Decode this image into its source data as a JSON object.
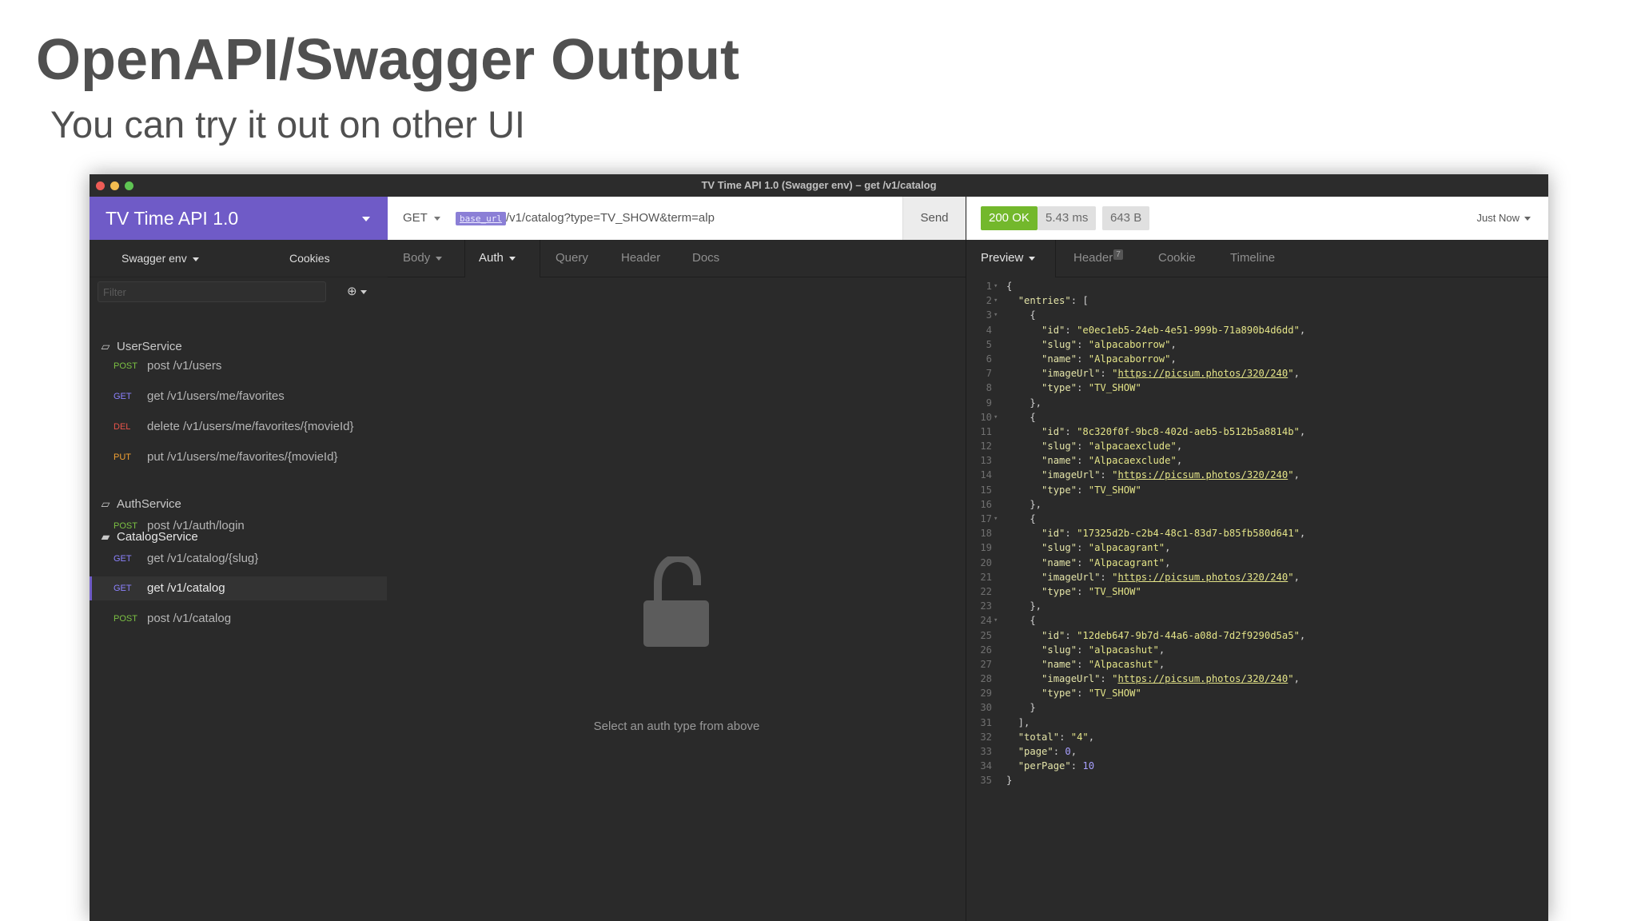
{
  "slide": {
    "title": "OpenAPI/Swagger Output",
    "subtitle": "You can try it out on other UI"
  },
  "window": {
    "title": "TV Time API 1.0 (Swagger env) – get /v1/catalog"
  },
  "sidebar": {
    "workspace": "TV Time API 1.0",
    "environment": "Swagger env",
    "cookies": "Cookies",
    "filter_placeholder": "Filter",
    "add_icon": "plus-circle-icon",
    "folders": [
      {
        "name": "UserService",
        "open": false,
        "requests": [
          {
            "method": "POST",
            "name": "post /v1/users"
          },
          {
            "method": "GET",
            "name": "get /v1/users/me/favorites"
          },
          {
            "method": "DEL",
            "name": "delete /v1/users/me/favorites/{movieId}"
          },
          {
            "method": "PUT",
            "name": "put /v1/users/me/favorites/{movieId}"
          }
        ]
      },
      {
        "name": "AuthService",
        "open": false,
        "requests": [
          {
            "method": "POST",
            "name": "post /v1/auth/login"
          }
        ]
      },
      {
        "name": "CatalogService",
        "open": true,
        "requests": [
          {
            "method": "GET",
            "name": "get /v1/catalog/{slug}"
          },
          {
            "method": "GET",
            "name": "get /v1/catalog",
            "active": true
          },
          {
            "method": "POST",
            "name": "post /v1/catalog"
          }
        ]
      }
    ]
  },
  "request": {
    "method": "GET",
    "url_var": "base_url",
    "url_path": "/v1/catalog?type=TV_SHOW&term=alp",
    "send_label": "Send",
    "tabs": [
      "Body",
      "Auth",
      "Query",
      "Header",
      "Docs"
    ],
    "active_tab": "Auth",
    "auth_empty_text": "Select an auth type from above"
  },
  "response": {
    "status": "200 OK",
    "time": "5.43 ms",
    "size": "643 B",
    "when": "Just Now",
    "tabs": [
      "Preview",
      "Header",
      "Cookie",
      "Timeline"
    ],
    "header_count": "7",
    "active_tab": "Preview",
    "body": {
      "entries": [
        {
          "id": "e0ec1eb5-24eb-4e51-999b-71a890b4d6dd",
          "slug": "alpacaborrow",
          "name": "Alpacaborrow",
          "imageUrl": "https://picsum.photos/320/240",
          "type": "TV_SHOW"
        },
        {
          "id": "8c320f0f-9bc8-402d-aeb5-b512b5a8814b",
          "slug": "alpacaexclude",
          "name": "Alpacaexclude",
          "imageUrl": "https://picsum.photos/320/240",
          "type": "TV_SHOW"
        },
        {
          "id": "17325d2b-c2b4-48c1-83d7-b85fb580d641",
          "slug": "alpacagrant",
          "name": "Alpacagrant",
          "imageUrl": "https://picsum.photos/320/240",
          "type": "TV_SHOW"
        },
        {
          "id": "12deb647-9b7d-44a6-a08d-7d2f9290d5a5",
          "slug": "alpacashut",
          "name": "Alpacashut",
          "imageUrl": "https://picsum.photos/320/240",
          "type": "TV_SHOW"
        }
      ],
      "total": "4",
      "page": 0,
      "perPage": 10
    }
  },
  "colors": {
    "accent": "#6f5bc7",
    "status_ok": "#73b82c",
    "method_get": "#8c82ff",
    "method_post": "#7bc043",
    "method_del": "#e8544a",
    "method_put": "#f2a133"
  }
}
